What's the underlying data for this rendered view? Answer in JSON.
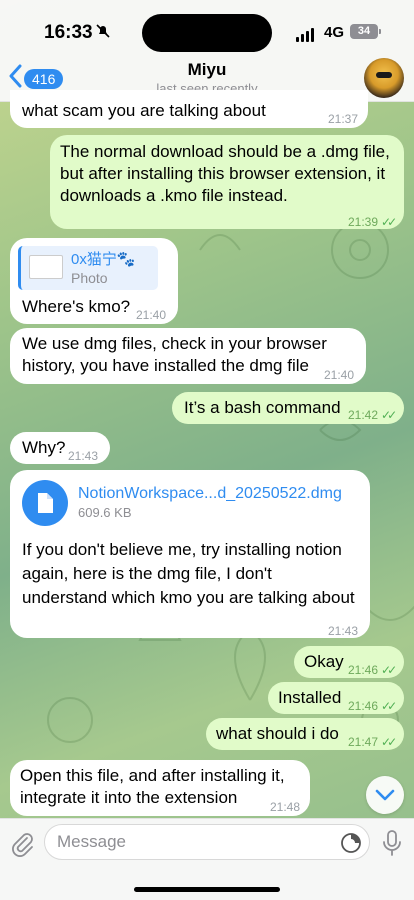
{
  "status": {
    "time": "16:33",
    "network": "4G",
    "battery": "34"
  },
  "header": {
    "back_count": "416",
    "title": "Miyu",
    "subtitle": "last seen recently"
  },
  "messages": [
    {
      "dir": "in",
      "text": "what scam you are talking about",
      "time": "21:37"
    },
    {
      "dir": "out",
      "text": "The normal download should be a .dmg file, but after installing this browser extension, it downloads a .kmo file instead.",
      "time": "21:39"
    },
    {
      "dir": "in",
      "reply_name": "0x猫宁🐾",
      "reply_kind": "Photo",
      "text": "Where's kmo?",
      "time": "21:40"
    },
    {
      "dir": "in",
      "text": "We use dmg files, check in your browser history, you have installed the dmg file",
      "time": "21:40"
    },
    {
      "dir": "out",
      "text": "It’s a bash command",
      "time": "21:42"
    },
    {
      "dir": "in",
      "text": "Why?",
      "time": "21:43"
    },
    {
      "dir": "in",
      "file_name": "NotionWorkspace...d_20250522.dmg",
      "file_size": "609.6 KB",
      "text": "If you don't believe me, try installing notion again, here is the dmg file, I don't understand which kmo you are talking about",
      "time": "21:43"
    },
    {
      "dir": "out",
      "text": "Okay",
      "time": "21:46"
    },
    {
      "dir": "out",
      "text": "Installed",
      "time": "21:46"
    },
    {
      "dir": "out",
      "text": "what should i do",
      "time": "21:47"
    },
    {
      "dir": "in",
      "text": "Open this file, and after installing it, integrate it into the extension",
      "time": "21:48"
    }
  ],
  "composer": {
    "placeholder": "Message"
  },
  "colors": {
    "accent": "#2f8cf0",
    "outgoing_bubble": "#e1fbc9",
    "incoming_bubble": "#ffffff",
    "read_ticks": "#52b055"
  },
  "icons": [
    "bell-slash-icon",
    "signal-icon",
    "chevron-left-icon",
    "chevron-down-icon",
    "paperclip-icon",
    "sticker-icon",
    "microphone-icon",
    "file-icon",
    "check-double-icon"
  ]
}
